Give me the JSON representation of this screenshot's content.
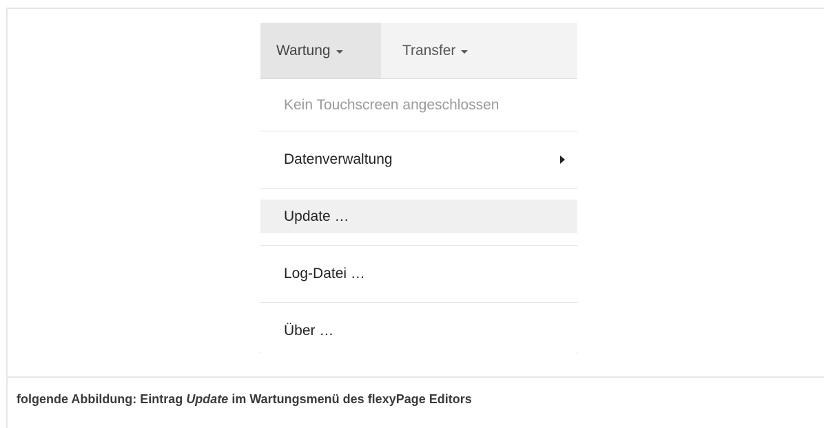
{
  "navbar": {
    "tabs": [
      {
        "label": "Wartung",
        "active": true
      },
      {
        "label": "Transfer",
        "active": false
      }
    ]
  },
  "menu": {
    "items": [
      {
        "label": "Kein Touchscreen angeschlossen",
        "disabled": true
      },
      {
        "label": "Datenverwaltung",
        "submenu": true
      },
      {
        "label": "Update …",
        "highlighted": true
      },
      {
        "label": "Log-Datei …"
      },
      {
        "label": "Über …"
      }
    ]
  },
  "caption": {
    "prefix": "folgende Abbildung: Eintrag ",
    "emphasis": "Update",
    "suffix": " im Wartungsmenü des flexyPage Editors"
  },
  "colors": {
    "navbar_bg": "#f3f3f3",
    "active_tab_bg": "#e5e5e5",
    "highlight_bg": "#f0f0f0",
    "disabled_text": "#9a9a9a"
  }
}
